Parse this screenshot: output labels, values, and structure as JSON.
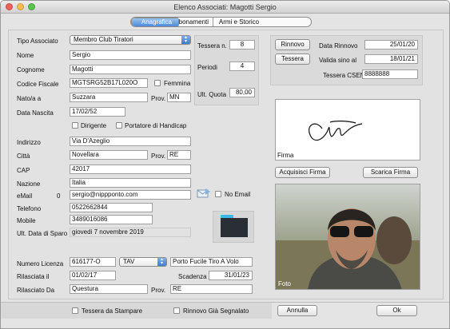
{
  "window": {
    "title": "Elenco Associati: Magotti Sergio"
  },
  "tabs": [
    "Anagrafica",
    "Movimenti e Abbonamenti",
    "Armi e Storico"
  ],
  "left": {
    "tipo_associato_label": "Tipo Associato",
    "tipo_associato_value": "Membro Club Tiratori",
    "nome_label": "Nome",
    "nome_value": "Sergio",
    "cognome_label": "Cognome",
    "cognome_value": "Magotti",
    "codice_fiscale_label": "Codice Fiscale",
    "codice_fiscale_value": "MGTSRG52B17L020O",
    "femmina_label": "Femmina",
    "nato_label": "Nato/a a",
    "nato_value": "Suzzara",
    "prov_label": "Prov.",
    "nato_prov_value": "MN",
    "data_nascita_label": "Data Nascita",
    "data_nascita_value": "17/02/52",
    "dirigente_label": "Dirigente",
    "handicap_label": "Portatore di Handicap",
    "indirizzo_label": "Indirizzo",
    "indirizzo_value": "Via D'Azeglio",
    "citta_label": "Città",
    "citta_value": "Novellara",
    "citta_prov_value": "RE",
    "cap_label": "CAP",
    "cap_value": "42017",
    "nazione_label": "Nazione",
    "nazione_value": "Italia",
    "email_label": "eMail",
    "email_count": "0",
    "email_value": "sergio@nippponto.com",
    "no_email_label": "No Email",
    "telefono_label": "Telefono",
    "telefono_value": "0522662844",
    "mobile_label": "Mobile",
    "mobile_value": "3489016086",
    "ult_sparo_label": "Ult. Data di Sparo",
    "ult_sparo_value": "giovedi 7 novembre 2019"
  },
  "quota": {
    "tessera_n_label": "Tessera n.",
    "tessera_n_value": "8",
    "periodi_label": "Periodi",
    "periodi_value": "4",
    "ult_quota_label": "Ult. Quota",
    "ult_quota_value": "80,00"
  },
  "right": {
    "rinnovo_button": "Rinnovo",
    "data_rinnovo_label": "Data Rinnovo",
    "data_rinnovo_value": "25/01/20",
    "tessera_button": "Tessera",
    "valida_label": "Valida sino al",
    "valida_value": "18/01/21",
    "tessera_csen_label": "Tessera CSEN",
    "tessera_csen_value": "8888888",
    "firma_label": "Firma",
    "acquisisci_firma_button": "Acquisisci Firma",
    "scarica_firma_button": "Scarica Firma",
    "foto_label": "Foto"
  },
  "licenza": {
    "numero_label": "Numero Licenza",
    "numero_value": "616177-O",
    "tipo_value": "TAV",
    "tipo_desc": "Porto Fucile Tiro A Volo",
    "rilasciata_label": "Rilasciata il",
    "rilasciata_value": "01/02/17",
    "scadenza_label": "Scadenza",
    "scadenza_value": "31/01/23",
    "rilasciato_da_label": "Rilasciato Da",
    "rilasciato_da_value": "Questura",
    "prov_label": "Prov.",
    "prov_value": "RE"
  },
  "bottom": {
    "tessera_stampare_label": "Tessera da Stampare",
    "rinnovo_segnalato_label": "Rinnovo Già Segnalato",
    "annulla_button": "Annulla",
    "ok_button": "Ok"
  },
  "colors": {
    "tab_selected": "#4b8ad8",
    "folder_icon": "#2a2f35",
    "folder_tab": "#39b9e3"
  }
}
